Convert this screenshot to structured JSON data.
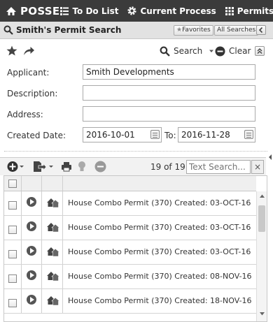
{
  "topbar": {
    "brand": "POSSE",
    "nav": [
      {
        "label": "To Do List",
        "icon": "list-icon"
      },
      {
        "label": "Current Process",
        "icon": "gear-icon"
      },
      {
        "label": "Permits",
        "icon": "grid-icon"
      }
    ]
  },
  "titlebar": {
    "title": "Smith's Permit Search",
    "favorites_label": "Favorites",
    "all_searches_label": "All Searches"
  },
  "actions": {
    "search_label": "Search",
    "clear_label": "Clear"
  },
  "form": {
    "applicant_label": "Applicant:",
    "applicant_value": "Smith Developments",
    "description_label": "Description:",
    "description_value": "",
    "address_label": "Address:",
    "address_value": "",
    "created_label": "Created Date:",
    "created_from": "2016-10-01",
    "to_label": "To:",
    "created_to": "2016-11-28"
  },
  "results": {
    "count": "19 of 19",
    "search_placeholder": "Text Search...",
    "close_label": "×",
    "rows": [
      "House Combo Permit (370) Created: 03-OCT-16",
      "House Combo Permit (370) Created: 03-OCT-16",
      "House Combo Permit (370) Created: 03-OCT-16",
      "House Combo Permit (370) Created: 08-NOV-16",
      "House Combo Permit (370) Created: 18-NOV-16"
    ]
  }
}
